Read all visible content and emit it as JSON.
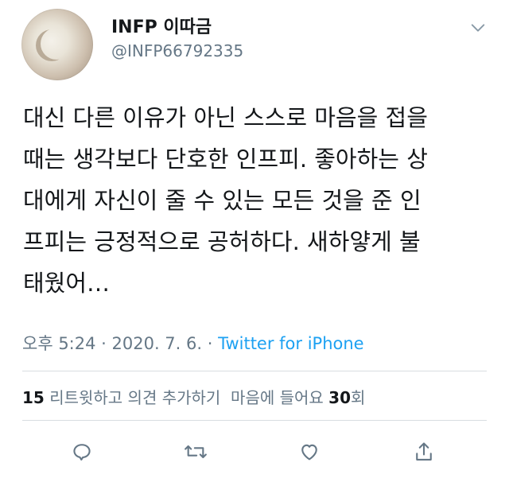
{
  "user": {
    "name": "INFP 이따금",
    "handle": "@INFP66792335",
    "avatar_icon": "crescent-moon-avatar"
  },
  "tweet": {
    "text": "대신 다른 이유가 아닌 스스로 마음을 접을\n때는 생각보다 단호한 인프피. 좋아하는 상\n대에게 자신이 줄 수 있는 모든 것을 준 인\n프피는 긍정적으로 공허하다. 새하얗게 불\n태웠어…",
    "time": "오후 5:24",
    "separator1": " · ",
    "date": "2020. 7. 6.",
    "separator2": " · ",
    "source": "Twitter for iPhone"
  },
  "stats": {
    "retweets_count": "15",
    "retweets_label": " 리트윗하고 의견 추가하기",
    "likes_label": "마음에 들어요 ",
    "likes_count": "30",
    "likes_suffix": "회"
  },
  "actions": {
    "reply_icon": "reply-icon",
    "retweet_icon": "retweet-icon",
    "like_icon": "heart-icon",
    "share_icon": "share-icon"
  },
  "colors": {
    "accent": "#1da1f2",
    "secondary_text": "#657786",
    "primary_text": "#14171a",
    "divider": "#d8dde1"
  }
}
